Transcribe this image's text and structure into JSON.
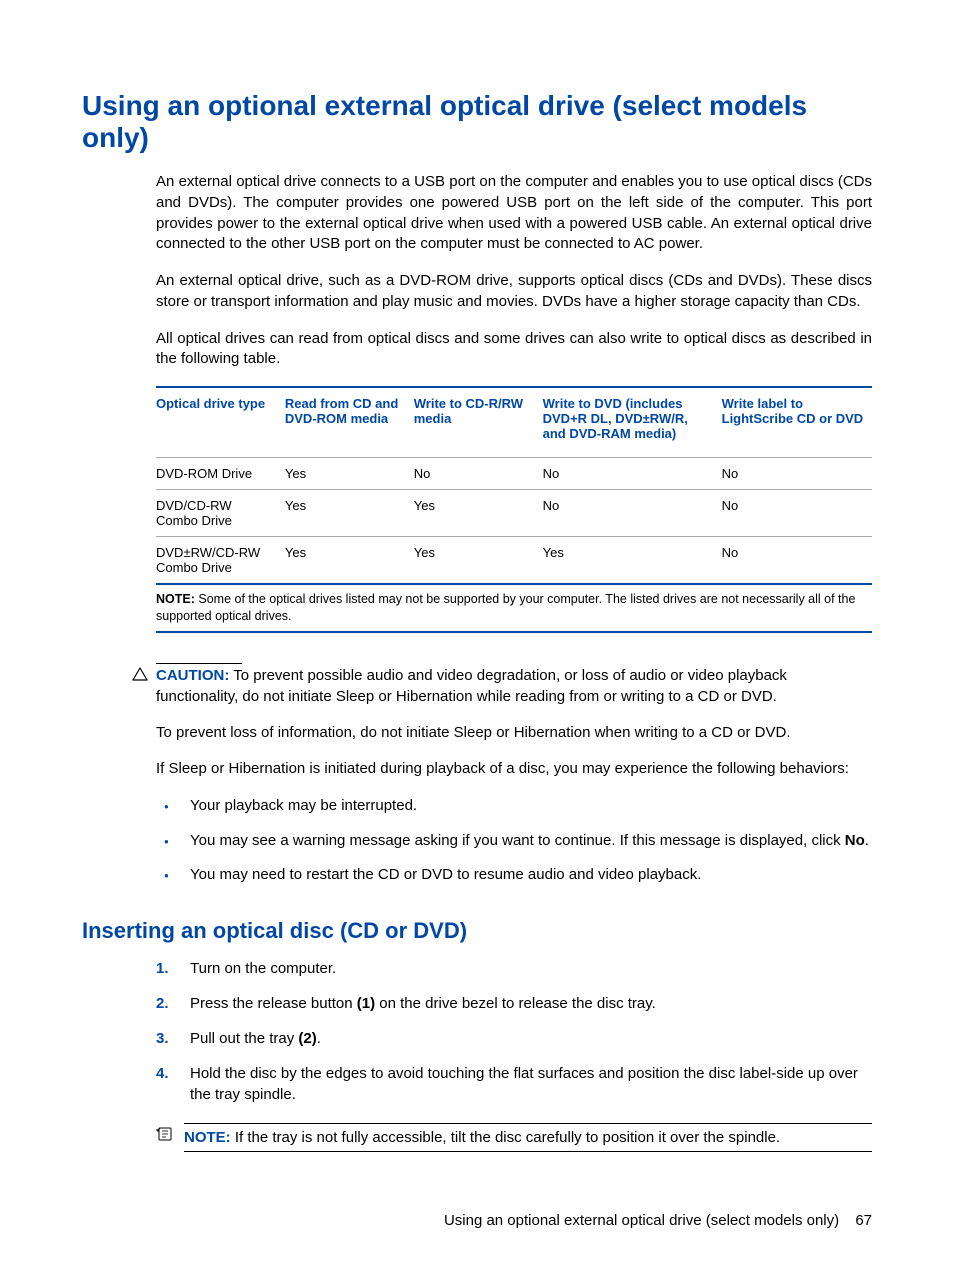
{
  "heading": "Using an optional external optical drive (select models only)",
  "intro_p1": "An external optical drive connects to a USB port on the computer and enables you to use optical discs (CDs and DVDs). The computer provides one powered USB port on the left side of the computer. This port provides power to the external optical drive when used with a powered USB cable. An external optical drive connected to the other USB port on the computer must be connected to AC power.",
  "intro_p2": "An external optical drive, such as a DVD-ROM drive, supports optical discs (CDs and DVDs). These discs store or transport information and play music and movies. DVDs have a higher storage capacity than CDs.",
  "intro_p3": "All optical drives can read from optical discs and some drives can also write to optical discs as described in the following table.",
  "table": {
    "headers": {
      "c1": "Optical drive type",
      "c2": "Read from CD and DVD-ROM media",
      "c3": "Write to CD-R/RW media",
      "c4": "Write to DVD (includes DVD+R DL, DVD±RW/R, and DVD-RAM media)",
      "c5": "Write label to LightScribe CD or DVD"
    },
    "rows": [
      {
        "c1": "DVD-ROM Drive",
        "c2": "Yes",
        "c3": "No",
        "c4": "No",
        "c5": "No"
      },
      {
        "c1": "DVD/CD-RW Combo Drive",
        "c2": "Yes",
        "c3": "Yes",
        "c4": "No",
        "c5": "No"
      },
      {
        "c1": "DVD±RW/CD-RW Combo Drive",
        "c2": "Yes",
        "c3": "Yes",
        "c4": "Yes",
        "c5": "No"
      }
    ],
    "note_label": "NOTE:",
    "note_text": "Some of the optical drives listed may not be supported by your computer. The listed drives are not necessarily all of the supported optical drives."
  },
  "caution": {
    "label": "CAUTION:",
    "text": "To prevent possible audio and video degradation, or loss of audio or video playback functionality, do not initiate Sleep or Hibernation while reading from or writing to a CD or DVD."
  },
  "caution_p2": "To prevent loss of information, do not initiate Sleep or Hibernation when writing to a CD or DVD.",
  "caution_p3": "If Sleep or Hibernation is initiated during playback of a disc, you may experience the following behaviors:",
  "bullets": {
    "b1": "Your playback may be interrupted.",
    "b2_pre": "You may see a warning message asking if you want to continue. If this message is displayed, click ",
    "b2_bold": "No",
    "b2_post": ".",
    "b3": "You may need to restart the CD or DVD to resume audio and video playback."
  },
  "subheading": "Inserting an optical disc (CD or DVD)",
  "steps": {
    "s1": "Turn on the computer.",
    "s2_pre": "Press the release button ",
    "s2_b": "(1)",
    "s2_post": " on the drive bezel to release the disc tray.",
    "s3_pre": "Pull out the tray ",
    "s3_b": "(2)",
    "s3_post": ".",
    "s4": "Hold the disc by the edges to avoid touching the flat surfaces and position the disc label-side up over the tray spindle."
  },
  "step_note": {
    "label": "NOTE:",
    "text": "If the tray is not fully accessible, tilt the disc carefully to position it over the spindle."
  },
  "footer": {
    "text": "Using an optional external optical drive (select models only)",
    "page": "67"
  },
  "nums": {
    "n1": "1.",
    "n2": "2.",
    "n3": "3.",
    "n4": "4."
  }
}
